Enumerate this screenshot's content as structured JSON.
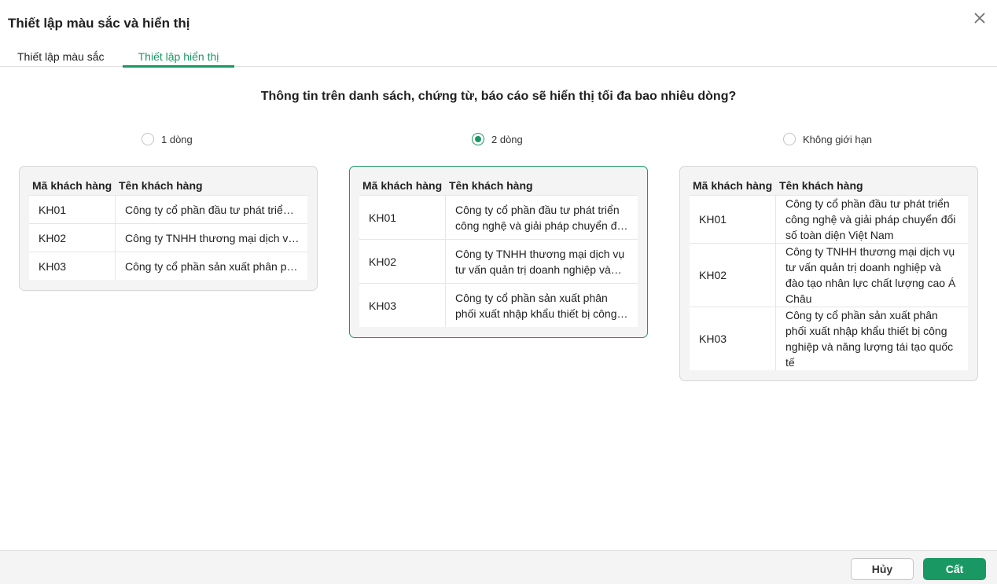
{
  "dialog": {
    "title": "Thiết lập màu sắc và hiển thị",
    "close_icon": "close-icon"
  },
  "tabs": [
    {
      "label": "Thiết lập màu sắc",
      "active": false
    },
    {
      "label": "Thiết lập hiển thị",
      "active": true
    }
  ],
  "question": "Thông tin trên danh sách, chứng từ, báo cáo sẽ hiển thị tối đa bao nhiêu dòng?",
  "options": [
    {
      "label": "1 dòng",
      "checked": false
    },
    {
      "label": "2 dòng",
      "checked": true
    },
    {
      "label": "Không giới hạn",
      "checked": false
    }
  ],
  "preview": {
    "col_code": "Mã khách hàng",
    "col_name": "Tên khách hàng",
    "rows": [
      {
        "code": "KH01",
        "name": "Công ty cổ phần đầu tư phát triển công nghệ và giải pháp chuyển đổi số toàn diện Việt Nam"
      },
      {
        "code": "KH02",
        "name": "Công ty TNHH thương mại dịch vụ tư vấn quản trị doanh nghiệp và đào tạo nhân lực chất lượng cao Á Châu"
      },
      {
        "code": "KH03",
        "name": "Công ty cổ phần sản xuất phân phối xuất nhập khẩu thiết bị công nghiệp và năng lượng tái tạo quốc tế"
      }
    ]
  },
  "footer": {
    "cancel_label": "Hủy",
    "save_label": "Cất"
  },
  "colors": {
    "accent": "#1a9863"
  }
}
